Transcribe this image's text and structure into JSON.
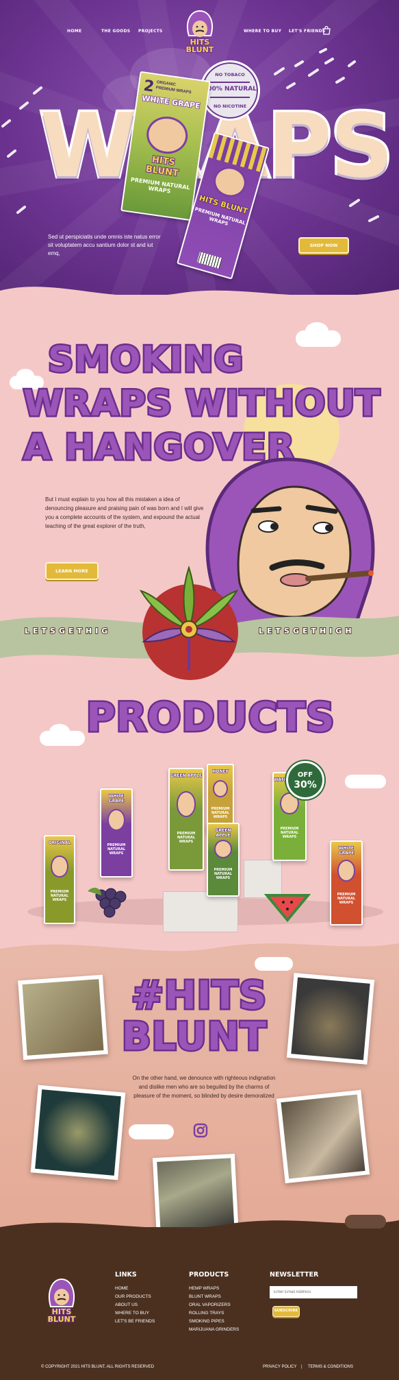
{
  "nav": {
    "left": [
      "HOME",
      "THE GOODS",
      "PROJECTS"
    ],
    "right": [
      "WHERE TO BUY",
      "LET'S FRIENDS"
    ]
  },
  "brand": {
    "line1": "HITS",
    "line2": "BLUNT"
  },
  "hero": {
    "big_word": "WRAPS",
    "text": "Sed ut perspiciatis unde omnis iste natus error sit voluptatem accu santium dolor st and iut emq,",
    "button": "SHOP NOW",
    "stamp_top": "NO TOBACO",
    "stamp_mid": "100% NATURAL",
    "stamp_bottom": "NO NICOTINE",
    "pack_front": {
      "count": "2",
      "line1": "ORGANIC",
      "line2": "PREMIUM WRAPS",
      "flavor": "WHITE GRAPE",
      "tag": "PREMIUM NATURAL WRAPS"
    },
    "pack_back": {
      "tag": "PREMIUM NATURAL WRAPS"
    }
  },
  "smoking": {
    "title_lines": [
      "SMOKING",
      "WRAPS WITHOUT",
      "A HANGOVER"
    ],
    "text": "But I must explain to you how all this mistaken a idea of denouncing pleasure and praising pain of was born and I will give you a complete accounts of the system, and expound the actual teaching of the great explorer of the truth,",
    "button": "LEARN MORE",
    "band_left": "LETSGETHIG",
    "band_right": "LETSGETHIGH"
  },
  "products": {
    "title": "PRODUCTS",
    "badge_top": "OFF",
    "badge_value": "30%",
    "packs": [
      {
        "flavor": "ORIGINAL",
        "color": "#8a9a2a"
      },
      {
        "flavor": "WHITE GRAPE",
        "color": "#7b3fa0"
      },
      {
        "flavor": "GREEN APPLE",
        "color": "#7a9a3a"
      },
      {
        "flavor": "HONEY",
        "color": "#c7a23a"
      },
      {
        "flavor": "GREEN APPLE",
        "color": "#5a8a3a"
      },
      {
        "flavor": "WATERMELON",
        "color": "#7ab03a"
      },
      {
        "flavor": "WHITE GRAPE",
        "color": "#d05030"
      }
    ],
    "pack_tag": "PREMIUM NATURAL WRAPS"
  },
  "social": {
    "title_lines": [
      "#HITS",
      "BLUNT"
    ],
    "text": "On the other hand, we denounce with righteous indignation and dislike men who are so beguiled by the charms of pleasure of the moment, so blinded by desire demoralized"
  },
  "footer": {
    "links_title": "LINKS",
    "links": [
      "HOME",
      "OUR PRODUCTS",
      "ABOUT US",
      "WHERE TO BUY",
      "LET'S BE FRIENDS"
    ],
    "products_title": "PRODUCTS",
    "products": [
      "HEMP WRAPS",
      "BLUNT WRAPS",
      "ORAL VAPORIZERS",
      "ROLLING TRAYS",
      "SMOKING PIPES",
      "MARIJUANA GRINDERS"
    ],
    "newsletter_title": "NEWSLETTER",
    "email_placeholder": "Enter Email Address",
    "subscribe": "SUBSCRIBE",
    "copyright": "© COPYRIGHT 2021 HITS BLUNT. ALL RIGHTS RESERVED",
    "privacy": "PRIVACY POLICY",
    "separator": "|",
    "terms": "TERMS & CONDITIONS"
  },
  "colors": {
    "purple": "#6b338f",
    "pink": "#f5c8c8",
    "yellow": "#e3b93a",
    "brown": "#4b3020",
    "sage": "#b8c4a0"
  }
}
